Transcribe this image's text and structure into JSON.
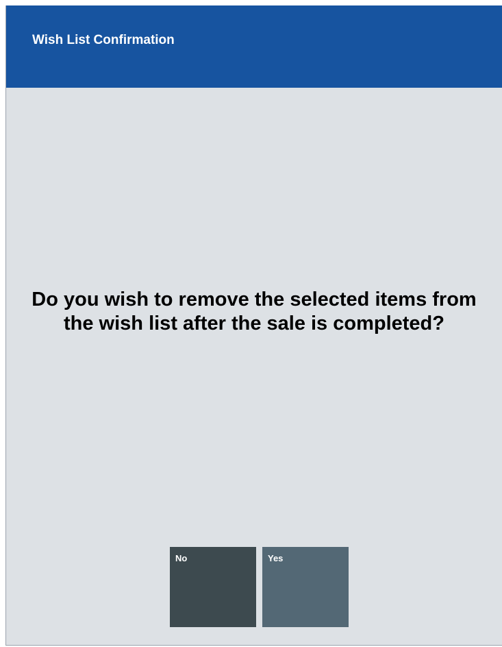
{
  "dialog": {
    "title": "Wish List Confirmation",
    "message": "Do you wish to remove the selected items from the wish list after the sale is completed?",
    "buttons": {
      "no_label": "No",
      "yes_label": "Yes"
    },
    "colors": {
      "header": "#1754a0",
      "background": "#dde1e5",
      "no_button": "#3d4a4f",
      "yes_button": "#536875"
    }
  }
}
